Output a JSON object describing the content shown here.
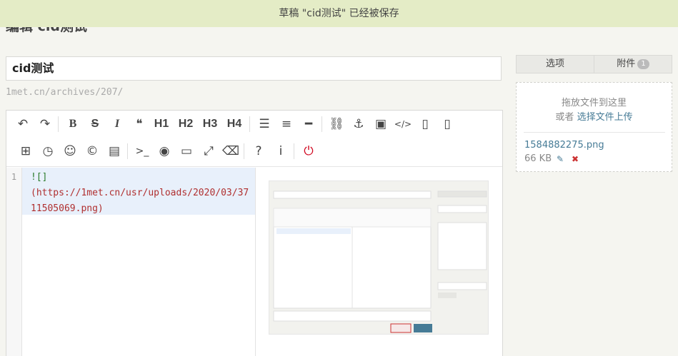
{
  "notice": "草稿 \"cid测试\" 已经被保存",
  "page_title": "编辑 cid测试",
  "post": {
    "title": "cid测试",
    "url": "1met.cn/archives/207/"
  },
  "toolbar": {
    "row1": [
      {
        "name": "undo-button",
        "label": "↶",
        "text": false
      },
      {
        "name": "redo-button",
        "label": "↷",
        "text": false
      },
      {
        "name": "sep"
      },
      {
        "name": "bold-button",
        "label": "B",
        "text": true
      },
      {
        "name": "strikethrough-button",
        "label": "S",
        "text": true
      },
      {
        "name": "italic-button",
        "label": "I",
        "text": true
      },
      {
        "name": "quote-button",
        "label": "❝",
        "text": false
      },
      {
        "name": "h1-button",
        "label": "H1",
        "text": true
      },
      {
        "name": "h2-button",
        "label": "H2",
        "text": true
      },
      {
        "name": "h3-button",
        "label": "H3",
        "text": true
      },
      {
        "name": "h4-button",
        "label": "H4",
        "text": true
      },
      {
        "name": "sep"
      },
      {
        "name": "bullet-list-button",
        "label": "☰",
        "text": false
      },
      {
        "name": "ordered-list-button",
        "label": "≡",
        "text": false
      },
      {
        "name": "horizontal-rule-button",
        "label": "━",
        "text": false
      },
      {
        "name": "sep"
      },
      {
        "name": "link-button",
        "label": "⛓",
        "text": false
      },
      {
        "name": "anchor-button",
        "label": "⚓",
        "text": false
      },
      {
        "name": "image-button",
        "label": "▣",
        "text": false
      },
      {
        "name": "code-button",
        "label": "</>",
        "text": false
      },
      {
        "name": "file-code-button",
        "label": "▯",
        "text": false
      },
      {
        "name": "file-code-button-2",
        "label": "▯",
        "text": false
      }
    ],
    "row2": [
      {
        "name": "table-button",
        "label": "⊞",
        "text": false
      },
      {
        "name": "clock-button",
        "label": "◷",
        "text": false
      },
      {
        "name": "emoji-button",
        "label": "☺",
        "text": false
      },
      {
        "name": "copyright-button",
        "label": "©",
        "text": false
      },
      {
        "name": "card-button",
        "label": "▤",
        "text": false
      },
      {
        "name": "sep"
      },
      {
        "name": "terminal-button",
        "label": ">_",
        "text": false
      },
      {
        "name": "preview-toggle-button",
        "label": "◉",
        "text": false
      },
      {
        "name": "desktop-button",
        "label": "▭",
        "text": false
      },
      {
        "name": "fullscreen-button",
        "label": "⤢",
        "text": false
      },
      {
        "name": "eraser-button",
        "label": "⌫",
        "text": false
      },
      {
        "name": "sep"
      },
      {
        "name": "help-button",
        "label": "?",
        "text": false
      },
      {
        "name": "info-button",
        "label": "i",
        "text": false
      },
      {
        "name": "sep"
      },
      {
        "name": "power-button",
        "label": "⏻",
        "text": false
      }
    ]
  },
  "editor": {
    "line_number": "1",
    "code_line1": "![]",
    "code_line2": "(https://1met.cn/usr/uploads/2020/03/37",
    "code_line3": "11505069.png)"
  },
  "sidebar": {
    "tab_options": "选项",
    "tab_attachments": "附件",
    "attachment_count": "1",
    "drop_text": "拖放文件到这里",
    "or_text": "或者 ",
    "select_link": "选择文件上传",
    "file": {
      "name": "1584882275.png",
      "size": "66 KB"
    }
  },
  "colors": {
    "notice_bg": "#e4ecc6",
    "link": "#467b96",
    "power": "#d0021b",
    "delete": "#c33"
  }
}
